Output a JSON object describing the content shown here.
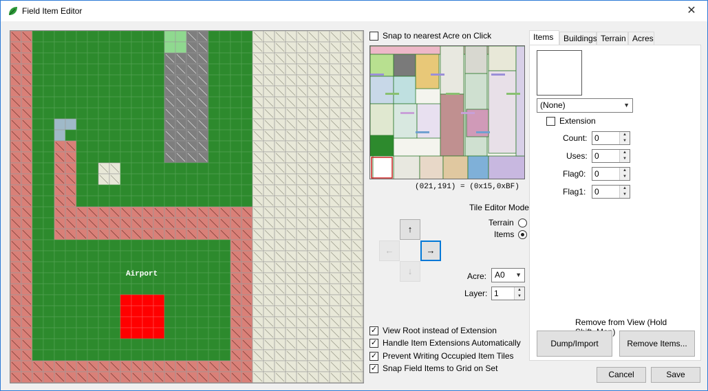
{
  "window": {
    "title": "Field Item Editor",
    "close_glyph": "✕",
    "icon": "leaf-icon"
  },
  "map": {
    "label": "Airport"
  },
  "colors": {
    "grass": "#2d8a2d",
    "cliff": "#d98078",
    "sand": "#e8e8d8",
    "stone": "#7e7e7e",
    "water": "#9fb9c8",
    "highlight": "#ff0000",
    "light_green": "#8fd98f"
  },
  "snap_checkbox": {
    "label": "Snap to nearest Acre on Click",
    "checked": false
  },
  "coords": "(021,191) = (0x15,0xBF)",
  "tile_editor": {
    "title": "Tile Editor Mode",
    "modes": [
      {
        "label": "Terrain",
        "selected": false
      },
      {
        "label": "Items",
        "selected": true
      }
    ]
  },
  "nav": {
    "up": "↑",
    "left": "←",
    "right": "→",
    "down": "↓"
  },
  "acre": {
    "label": "Acre:",
    "value": "A0"
  },
  "layer": {
    "label": "Layer:",
    "value": "1"
  },
  "options": [
    {
      "label": "View Root instead of Extension",
      "checked": true
    },
    {
      "label": "Handle Item Extensions Automatically",
      "checked": true
    },
    {
      "label": "Prevent Writing Occupied Item Tiles",
      "checked": true
    },
    {
      "label": "Snap Field Items to Grid on Set",
      "checked": true
    }
  ],
  "tabs": [
    {
      "label": "Items",
      "active": true
    },
    {
      "label": "Buildings",
      "active": false
    },
    {
      "label": "Terrain",
      "active": false
    },
    {
      "label": "Acres",
      "active": false
    }
  ],
  "item": {
    "selected": "(None)",
    "extension_label": "Extension",
    "extension_checked": false
  },
  "fields": [
    {
      "label": "Count:",
      "value": "0"
    },
    {
      "label": "Uses:",
      "value": "0"
    },
    {
      "label": "Flag0:",
      "value": "0"
    },
    {
      "label": "Flag1:",
      "value": "0"
    }
  ],
  "remove_hint": "Remove from View (Hold Shift=Map)",
  "buttons": {
    "dump": "Dump/Import",
    "remove": "Remove Items...",
    "cancel": "Cancel",
    "save": "Save"
  }
}
